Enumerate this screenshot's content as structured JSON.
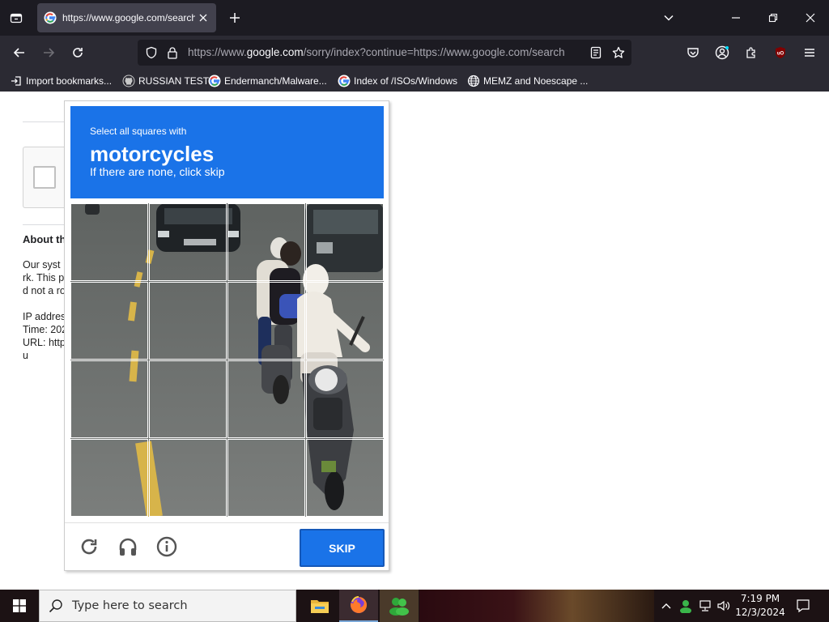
{
  "browser": {
    "tab": {
      "title": "https://www.google.com/search"
    },
    "url": {
      "prefix": "https://www.",
      "domain": "google.com",
      "rest": "/sorry/index?continue=https://www.google.com/search"
    },
    "bookmarks": [
      {
        "label": "Import bookmarks...",
        "icon": "import-icon"
      },
      {
        "label": "RUSSIAN TEST",
        "icon": "github-icon"
      },
      {
        "label": "Endermanch/Malware...",
        "icon": "google-icon"
      },
      {
        "label": "Index of /ISOs/Windows",
        "icon": "google-icon"
      },
      {
        "label": "MEMZ and Noescape ...",
        "icon": "globe-icon"
      }
    ]
  },
  "page": {
    "about_heading": "About th",
    "lines": [
      "Our syst",
      "rk. This p",
      "d not a ro",
      "IP addres",
      "Time: 202",
      "URL: http",
      "u"
    ]
  },
  "captcha": {
    "instruction_small": "Select all squares with",
    "target": "motorcycles",
    "instruction_sub": "If there are none, click skip",
    "skip_label": "SKIP",
    "grid_size": 4,
    "colors": {
      "header": "#1a73e8",
      "button": "#1a73e8"
    }
  },
  "taskbar": {
    "search_placeholder": "Type here to search",
    "time": "7:19 PM",
    "date": "12/3/2024"
  }
}
